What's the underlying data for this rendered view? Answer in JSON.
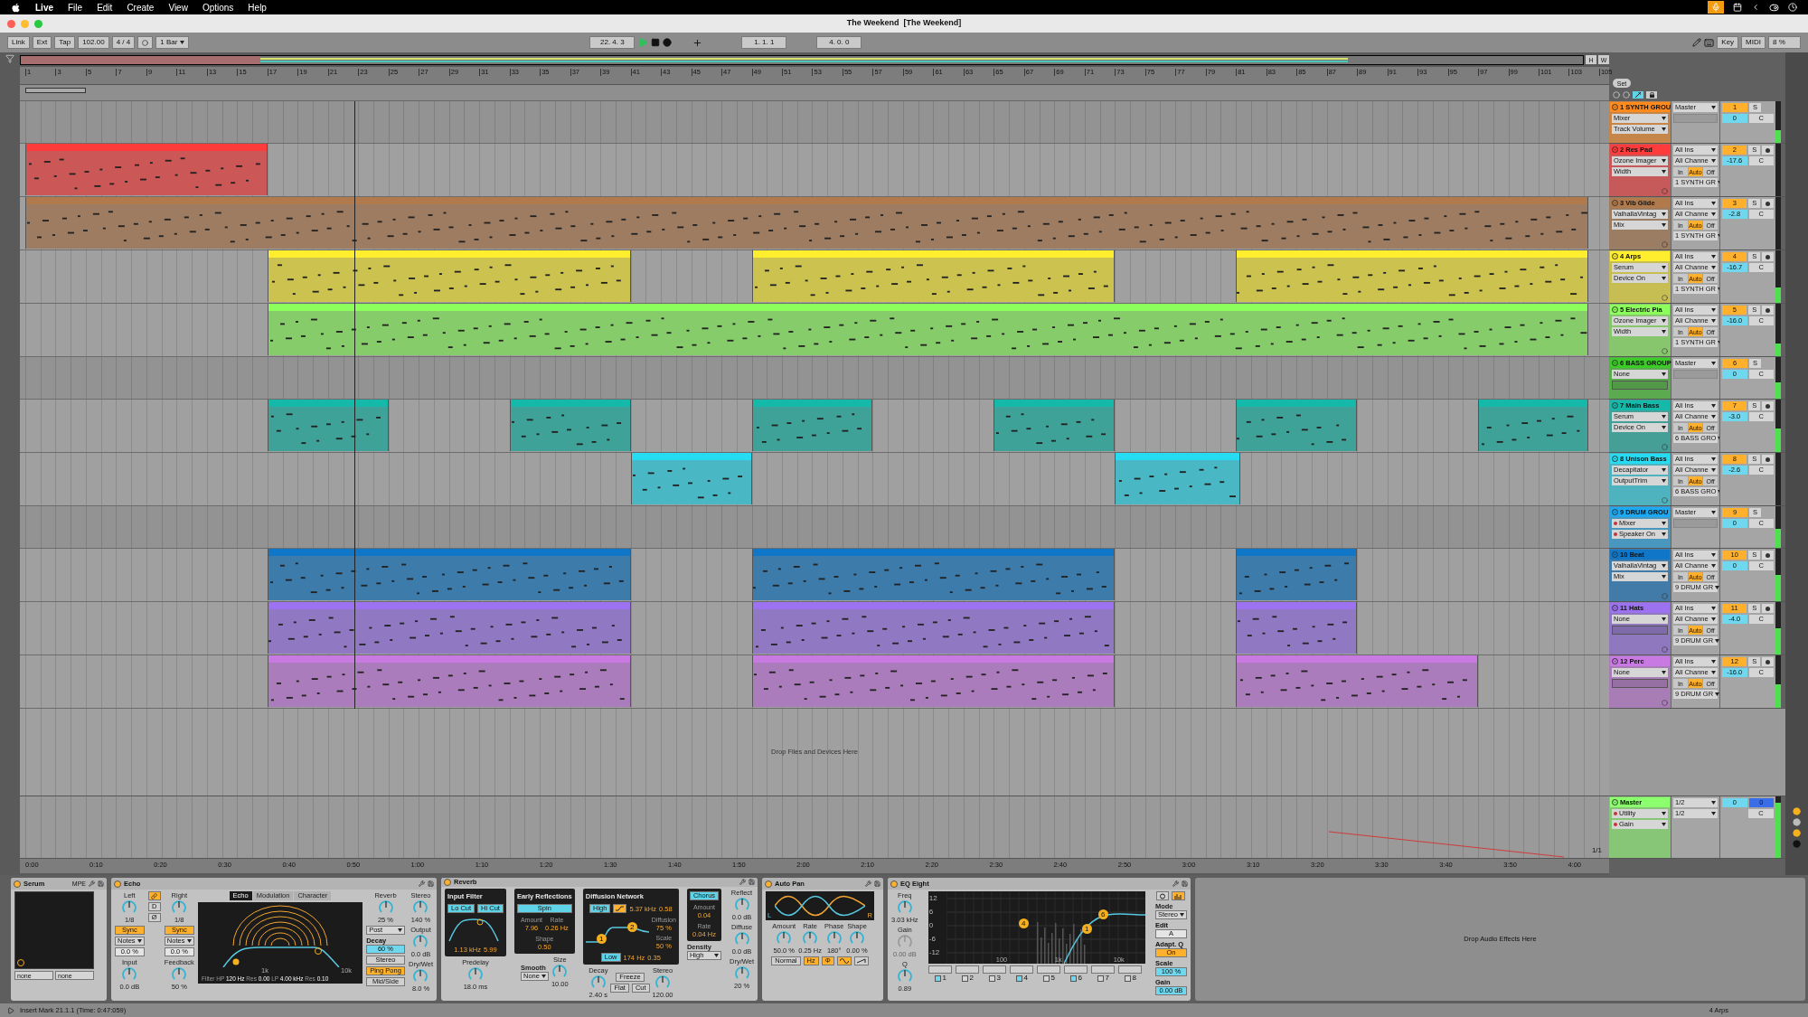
{
  "menubar": {
    "app": "Live",
    "items": [
      "File",
      "Edit",
      "Create",
      "View",
      "Options",
      "Help"
    ]
  },
  "window": {
    "title": "The Weekend  [The Weekend]"
  },
  "control_bar": {
    "link": "Link",
    "ext": "Ext",
    "tap": "Tap",
    "tempo": "102.00",
    "signature": "4 / 4",
    "quantization": "1 Bar",
    "position": "22. 4. 3",
    "playing": true,
    "loop_start": "1. 1. 1",
    "loop_length": "4. 0. 0",
    "key": "Key",
    "midi": "MIDI",
    "cpu": "8 %"
  },
  "overview_buttons": [
    "H",
    "W"
  ],
  "ruler_bars": [
    "1",
    "3",
    "5",
    "7",
    "9",
    "11",
    "13",
    "15",
    "17",
    "19",
    "21",
    "23",
    "25",
    "27",
    "29",
    "31",
    "33",
    "35",
    "37",
    "39",
    "41",
    "43",
    "45",
    "47",
    "49",
    "51",
    "53",
    "55",
    "57",
    "59",
    "61",
    "63",
    "65",
    "67",
    "69",
    "71",
    "73",
    "75",
    "77",
    "79",
    "81",
    "83",
    "85",
    "87",
    "89",
    "91",
    "93",
    "95",
    "97",
    "99",
    "101",
    "103",
    "105"
  ],
  "set_button": "Set",
  "arrangement_toggles": [
    {
      "kind": "expand",
      "on": true
    },
    {
      "kind": "lock",
      "on": false
    }
  ],
  "tracks": [
    {
      "name": "1 SYNTH GROU",
      "kind": "group",
      "color": "#ff8a1e",
      "automated": false,
      "devices": [
        "Mixer",
        "Track Volume"
      ],
      "output": "Master",
      "number": "1",
      "solo": "S",
      "volume": "0",
      "pan": "C",
      "level": 0.3
    },
    {
      "name": "2 Res Pad",
      "kind": "track",
      "color": "#ff3b3b",
      "automated": false,
      "devices": [
        "Ozone Imager",
        "Width"
      ],
      "input": "All Ins",
      "channel": "All Channe",
      "monitor": [
        {
          "label": "In",
          "selected": false
        },
        {
          "label": "Auto",
          "selected": true
        },
        {
          "label": "Off",
          "selected": false
        }
      ],
      "output": "1 SYNTH GR",
      "number": "2",
      "solo": "S",
      "volume": "-17.6",
      "pan": "C",
      "level": 0
    },
    {
      "name": "3 Vib Glide",
      "kind": "track",
      "color": "#b07a4c",
      "automated": false,
      "devices": [
        "ValhallaVintag",
        "Mix"
      ],
      "input": "All Ins",
      "channel": "All Channe",
      "monitor": [
        {
          "label": "In",
          "selected": false
        },
        {
          "label": "Auto",
          "selected": true
        },
        {
          "label": "Off",
          "selected": false
        }
      ],
      "output": "1 SYNTH GR",
      "number": "3",
      "solo": "S",
      "volume": "-2.8",
      "pan": "C",
      "level": 0
    },
    {
      "name": "4 Arps",
      "kind": "track",
      "color": "#ffee2e",
      "automated": false,
      "devices": [
        "Serum",
        "Device On"
      ],
      "input": "All Ins",
      "channel": "All Channe",
      "monitor": [
        {
          "label": "In",
          "selected": false
        },
        {
          "label": "Auto",
          "selected": true
        },
        {
          "label": "Off",
          "selected": false
        }
      ],
      "output": "1 SYNTH GR",
      "number": "4",
      "solo": "S",
      "volume": "-16.7",
      "pan": "C",
      "level": 0.3
    },
    {
      "name": "5 Electric Pia",
      "kind": "track",
      "color": "#8cff5c",
      "automated": false,
      "devices": [
        "Ozone Imager",
        "Width"
      ],
      "input": "All Ins",
      "channel": "All Channe",
      "monitor": [
        {
          "label": "In",
          "selected": false
        },
        {
          "label": "Auto",
          "selected": true
        },
        {
          "label": "Off",
          "selected": false
        }
      ],
      "output": "1 SYNTH GR",
      "number": "5",
      "solo": "S",
      "volume": "-16.0",
      "pan": "C",
      "level": 0.25
    },
    {
      "name": "6 BASS GROUP",
      "kind": "group",
      "color": "#3ccc28",
      "automated": false,
      "devices": [
        "None"
      ],
      "output": "Master",
      "number": "6",
      "solo": "S",
      "volume": "0",
      "pan": "C",
      "level": 0.4
    },
    {
      "name": "7 Main Bass",
      "kind": "track",
      "color": "#14b9aa",
      "automated": false,
      "devices": [
        "Serum",
        "Device On"
      ],
      "input": "All Ins",
      "channel": "All Channe",
      "monitor": [
        {
          "label": "In",
          "selected": false
        },
        {
          "label": "Auto",
          "selected": true
        },
        {
          "label": "Off",
          "selected": false
        }
      ],
      "output": "6 BASS GRO",
      "number": "7",
      "solo": "S",
      "volume": "-3.0",
      "pan": "C",
      "level": 0.45
    },
    {
      "name": "8 Unison Bass",
      "kind": "track",
      "color": "#26dcf2",
      "automated": false,
      "devices": [
        "Decapitator",
        "OutputTrim"
      ],
      "input": "All Ins",
      "channel": "All Channe",
      "monitor": [
        {
          "label": "In",
          "selected": false
        },
        {
          "label": "Auto",
          "selected": true
        },
        {
          "label": "Off",
          "selected": false
        }
      ],
      "output": "6 BASS GRO",
      "number": "8",
      "solo": "S",
      "volume": "-2.6",
      "pan": "C",
      "level": 0
    },
    {
      "name": "9 DRUM GROU",
      "kind": "group",
      "color": "#1ca9f2",
      "automated": true,
      "devices": [
        "Mixer",
        "Speaker On"
      ],
      "output": "Master",
      "number": "9",
      "solo": "S",
      "volume": "0",
      "pan": "C",
      "level": 0.45
    },
    {
      "name": "10 Beat",
      "kind": "track",
      "color": "#1077c8",
      "automated": false,
      "devices": [
        "ValhallaVintag",
        "Mix"
      ],
      "input": "All Ins",
      "channel": "All Channe",
      "monitor": [
        {
          "label": "In",
          "selected": false
        },
        {
          "label": "Auto",
          "selected": true
        },
        {
          "label": "Off",
          "selected": false
        }
      ],
      "output": "9 DRUM GR",
      "number": "10",
      "solo": "S",
      "volume": "0",
      "pan": "C",
      "level": 0.5
    },
    {
      "name": "11 Hats",
      "kind": "track",
      "color": "#9c72f0",
      "automated": false,
      "devices": [
        "None"
      ],
      "input": "All Ins",
      "channel": "All Channe",
      "monitor": [
        {
          "label": "In",
          "selected": false
        },
        {
          "label": "Auto",
          "selected": true
        },
        {
          "label": "Off",
          "selected": false
        }
      ],
      "output": "9 DRUM GR",
      "number": "11",
      "solo": "S",
      "volume": "-4.0",
      "pan": "C",
      "level": 0.5
    },
    {
      "name": "12 Perc",
      "kind": "track",
      "color": "#c87ae2",
      "automated": false,
      "devices": [
        "None"
      ],
      "input": "All Ins",
      "channel": "All Channe",
      "monitor": [
        {
          "label": "In",
          "selected": false
        },
        {
          "label": "Auto",
          "selected": true
        },
        {
          "label": "Off",
          "selected": false
        }
      ],
      "output": "9 DRUM GR",
      "number": "12",
      "solo": "S",
      "volume": "-16.0",
      "pan": "C",
      "level": 0.45
    }
  ],
  "drop_hint": "Drop Files and Devices Here",
  "master": {
    "name": "Master",
    "color": "#8cff6e",
    "automated": true,
    "devices": [
      "Utility",
      "Gain"
    ],
    "inputs": [
      "1/2",
      "1/2"
    ],
    "volume": "0",
    "cue": "0",
    "pan": "C",
    "level": 0.9
  },
  "zoom_label": "1/1",
  "time_ruler": [
    "0:00",
    "0:10",
    "0:20",
    "0:30",
    "0:40",
    "0:50",
    "1:00",
    "1:10",
    "1:20",
    "1:30",
    "1:40",
    "1:50",
    "2:00",
    "2:10",
    "2:20",
    "2:30",
    "2:40",
    "2:50",
    "3:00",
    "3:10",
    "3:20",
    "3:30",
    "3:40",
    "3:50",
    "4:00"
  ],
  "devices": [
    {
      "kind": "instrument",
      "title": "Serum",
      "tag": "MPE",
      "on": true,
      "columns": [
        [
          {
            "kind": "xy-pad"
          },
          {
            "kind": "fields",
            "values": [
              "none",
              "none"
            ]
          }
        ]
      ]
    },
    {
      "kind": "echo",
      "title": "Echo",
      "on": true,
      "columns": [
        [
          {
            "kind": "knob",
            "name": "Left",
            "reading": "1/8"
          },
          {
            "kind": "toggle",
            "label": "Sync",
            "on": true
          },
          {
            "kind": "select",
            "value": "Notes"
          },
          {
            "kind": "field",
            "value": "0.0 %",
            "on": false
          },
          {
            "kind": "knob",
            "name": "Input",
            "reading": "0.0 dB"
          }
        ],
        [
          {
            "kind": "link-toggle",
            "on": true
          },
          {
            "kind": "toggle",
            "label": "D",
            "on": false
          },
          {
            "kind": "toggle",
            "label": "Ø",
            "on": false
          }
        ],
        [
          {
            "kind": "knob",
            "name": "Right",
            "reading": "1/8"
          },
          {
            "kind": "toggle",
            "label": "Sync",
            "on": true
          },
          {
            "kind": "select",
            "value": "Notes"
          },
          {
            "kind": "field",
            "value": "0.0 %",
            "on": false
          },
          {
            "kind": "knob",
            "name": "Feedback",
            "reading": "50 %"
          }
        ],
        [
          {
            "kind": "tabs",
            "tabs": [
              {
                "label": "Echo",
                "selected": true
              },
              {
                "label": "Modulation",
                "selected": false
              },
              {
                "label": "Character",
                "selected": false
              }
            ]
          },
          {
            "kind": "echo-graph",
            "labels": [
              "1k",
              "10k"
            ],
            "caption": "Filter HP **120 Hz** Res **0.00** LP **4.00 kHz** Res **0.10**"
          }
        ],
        [
          {
            "kind": "knob",
            "name": "Reverb",
            "reading": "25 %"
          },
          {
            "kind": "select",
            "value": "Post"
          },
          {
            "kind": "field",
            "label": "Decay",
            "value": "60 %",
            "on": true
          },
          {
            "kind": "toggle",
            "label": "Stereo",
            "on": false
          },
          {
            "kind": "toggle",
            "label": "Ping Pong",
            "on": true
          },
          {
            "kind": "toggle",
            "label": "Mid/Side",
            "on": false
          }
        ],
        [
          {
            "kind": "knob",
            "name": "Stereo",
            "reading": "140 %"
          },
          {
            "kind": "knob",
            "name": "Output",
            "reading": "0.0 dB"
          },
          {
            "kind": "knob",
            "name": "Dry/Wet",
            "reading": "8.0 %"
          }
        ]
      ]
    },
    {
      "kind": "reverb",
      "title": "Reverb",
      "on": true,
      "columns": [
        [
          {
            "kind": "panel",
            "title": "Input Filter",
            "controls": [
              {
                "kind": "row",
                "controls": [
                  {
                    "kind": "toggle",
                    "label": "Lo Cut",
                    "on": true
                  },
                  {
                    "kind": "toggle",
                    "label": "Hi Cut",
                    "on": true
                  }
                ]
              },
              {
                "kind": "filter-curve"
              },
              {
                "kind": "row",
                "controls": [
                  {
                    "kind": "readout",
                    "value": "1.13 kHz"
                  },
                  {
                    "kind": "readout",
                    "value": "5.99"
                  }
                ]
              }
            ]
          },
          {
            "kind": "knob",
            "name": "Predelay",
            "reading": "18.0 ms"
          }
        ],
        [
          {
            "kind": "panel",
            "title": "Early Reflections",
            "controls": [
              {
                "kind": "toggle",
                "label": "Spin",
                "on": true
              },
              {
                "kind": "row",
                "controls": [
                  {
                    "kind": "readout",
                    "label": "Amount",
                    "value": "7.96"
                  },
                  {
                    "kind": "readout",
                    "label": "Rate",
                    "value": "0.26 Hz"
                  }
                ]
              },
              {
                "kind": "readout",
                "label": "Shape",
                "value": "0.50"
              }
            ]
          },
          {
            "kind": "row",
            "controls": [
              {
                "kind": "select",
                "label": "Smooth",
                "value": "None"
              },
              {
                "kind": "knob",
                "name": "Size",
                "reading": "10.00"
              }
            ]
          }
        ],
        [
          {
            "kind": "panel",
            "title": "Diffusion Network",
            "controls": [
              {
                "kind": "row",
                "controls": [
                  {
                    "kind": "toggle",
                    "label": "High",
                    "on": true
                  },
                  {
                    "kind": "shelf-toggle",
                    "on": true
                  },
                  {
                    "kind": "readout",
                    "value": "5.37 kHz"
                  },
                  {
                    "kind": "readout",
                    "value": "0.58"
                  }
                ]
              },
              {
                "kind": "row",
                "controls": [
                  {
                    "kind": "diffusion-curve",
                    "labels": [
                      "1",
                      "2"
                    ]
                  },
                  {
                    "kind": "stack",
                    "controls": [
                      {
                        "kind": "readout",
                        "label": "Diffusion",
                        "value": "75 %"
                      },
                      {
                        "kind": "readout",
                        "label": "Scale",
                        "value": "50 %"
                      }
                    ]
                  }
                ]
              },
              {
                "kind": "row",
                "controls": [
                  {
                    "kind": "toggle",
                    "label": "Low",
                    "on": true
                  },
                  {
                    "kind": "readout",
                    "value": "174 Hz"
                  },
                  {
                    "kind": "readout",
                    "value": "0.35"
                  }
                ]
              }
            ]
          },
          {
            "kind": "row",
            "controls": [
              {
                "kind": "knob",
                "name": "Decay",
                "reading": "2.40 s"
              },
              {
                "kind": "stack",
                "controls": [
                  {
                    "kind": "toggle",
                    "label": "Freeze",
                    "on": false
                  },
                  {
                    "kind": "row",
                    "controls": [
                      {
                        "kind": "toggle",
                        "label": "Flat",
                        "on": false
                      },
                      {
                        "kind": "toggle",
                        "label": "Cut",
                        "on": false
                      }
                    ]
                  }
                ]
              },
              {
                "kind": "knob",
                "name": "Stereo",
                "reading": "120.00"
              }
            ]
          }
        ],
        [
          {
            "kind": "panel",
            "controls": [
              {
                "kind": "toggle",
                "label": "Chorus",
                "on": true
              },
              {
                "kind": "readout",
                "label": "Amount",
                "value": "0.04"
              },
              {
                "kind": "readout",
                "label": "Rate",
                "value": "0.04 Hz"
              }
            ]
          },
          {
            "kind": "select",
            "label": "Density",
            "value": "High"
          }
        ],
        [
          {
            "kind": "knob",
            "name": "Reflect",
            "reading": "0.0 dB"
          },
          {
            "kind": "knob",
            "name": "Diffuse",
            "reading": "0.0 dB"
          },
          {
            "kind": "knob",
            "name": "Dry/Wet",
            "reading": "20 %"
          }
        ]
      ]
    },
    {
      "kind": "autopan",
      "title": "Auto Pan",
      "on": true,
      "columns": [
        [
          {
            "kind": "lfo-wave",
            "labels": [
              "L",
              "R"
            ]
          },
          {
            "kind": "row",
            "controls": [
              {
                "kind": "knob",
                "name": "Amount",
                "reading": "50.0 %"
              },
              {
                "kind": "knob",
                "name": "Rate",
                "reading": "0.25 Hz"
              },
              {
                "kind": "knob",
                "name": "Phase",
                "reading": "180°"
              },
              {
                "kind": "knob",
                "name": "Shape",
                "reading": "0.00 %"
              }
            ]
          },
          {
            "kind": "row",
            "controls": [
              {
                "kind": "toggle",
                "label": "Normal",
                "on": false
              },
              {
                "kind": "toggle",
                "label": "Hz",
                "on": true
              },
              {
                "kind": "toggle",
                "label": "Φ",
                "on": true
              },
              {
                "kind": "sine-toggle",
                "on": true
              },
              {
                "kind": "saw-toggle",
                "on": false
              }
            ]
          }
        ]
      ]
    },
    {
      "kind": "eq",
      "title": "EQ Eight",
      "on": true,
      "columns": [
        [
          {
            "kind": "knob",
            "name": "Freq",
            "reading": "3.03 kHz"
          },
          {
            "kind": "knob",
            "name": "Gain",
            "reading": "0.00 dB",
            "disabled": true
          },
          {
            "kind": "knob",
            "name": "Q",
            "reading": "0.89"
          }
        ],
        [
          {
            "kind": "eq-graph",
            "y_labels": [
              "12",
              "6",
              "0",
              "-6",
              "-12"
            ],
            "labels": [
              "100",
              "1k",
              "10k"
            ],
            "points": [
              "4",
              "1",
              "6"
            ]
          },
          {
            "kind": "bands",
            "bands": [
              {
                "label": "1",
                "on": true
              },
              {
                "label": "2",
                "on": false
              },
              {
                "label": "3",
                "on": false
              },
              {
                "label": "4",
                "on": true
              },
              {
                "label": "5",
                "on": false
              },
              {
                "label": "6",
                "on": true
              },
              {
                "label": "7",
                "on": false
              },
              {
                "label": "8",
                "on": false
              }
            ]
          }
        ],
        [
          {
            "kind": "row",
            "controls": [
              {
                "kind": "loop-toggle",
                "on": false
              },
              {
                "kind": "spectrum-toggle",
                "on": true
              }
            ]
          },
          {
            "kind": "select",
            "label": "Mode",
            "value": "Stereo"
          },
          {
            "kind": "field",
            "label": "Edit",
            "value": "A",
            "on": false
          },
          {
            "kind": "toggle",
            "caption": "Adapt. Q",
            "label": "On",
            "on": true
          },
          {
            "kind": "field",
            "label": "Scale",
            "value": "100 %",
            "on": true
          },
          {
            "kind": "field",
            "label": "Gain",
            "value": "0.00 dB",
            "on": true
          }
        ]
      ]
    }
  ],
  "drop_effects": "Drop Audio Effects Here",
  "status_bar": {
    "message": "Insert Mark 21.1.1 (Time: 0:47:059)",
    "track": "4 Arps"
  }
}
